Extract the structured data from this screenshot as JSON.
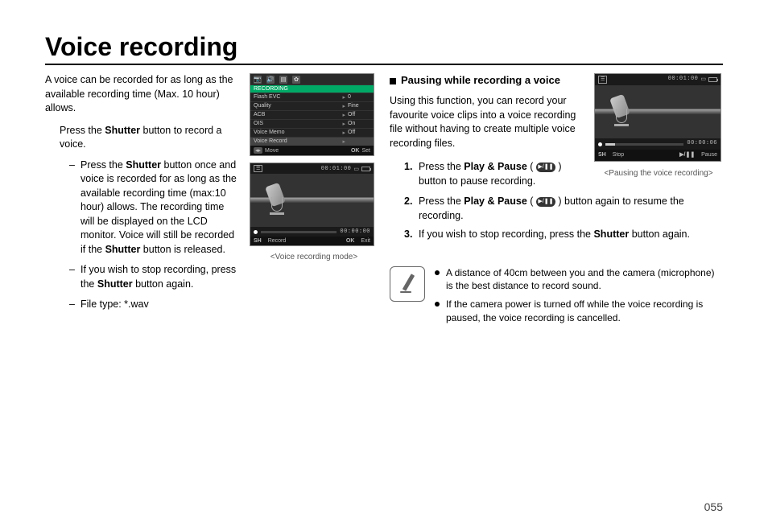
{
  "title": "Voice recording",
  "page_number": "055",
  "left": {
    "intro": "A voice can be recorded for as long as the available recording time (Max. 10 hour) allows.",
    "press_line_pre": "Press the ",
    "shutter_word": "Shutter",
    "press_line_post": " button to record a voice.",
    "bullets": [
      {
        "pre": "Press the ",
        "b1": "Shutter",
        "mid": " button once and voice is recorded for as long as the available recording time (max:10 hour) allows. The recording time will be displayed on the LCD monitor. Voice will still be recorded if the ",
        "b2": "Shutter",
        "post": " button is released."
      },
      {
        "pre": "If you wish to stop recording, press the ",
        "b1": "Shutter",
        "post": " button again."
      },
      {
        "plain": "File type: *.wav"
      }
    ]
  },
  "menu_shot": {
    "header": "RECORDING",
    "rows": [
      {
        "label": "Flash EVC",
        "value": "0"
      },
      {
        "label": "Quality",
        "value": "Fine"
      },
      {
        "label": "ACB",
        "value": "Off"
      },
      {
        "label": "OIS",
        "value": "On"
      },
      {
        "label": "Voice Memo",
        "value": "Off"
      },
      {
        "label": "Voice Record",
        "value": ""
      }
    ],
    "foot_left": "Move",
    "foot_right_k": "OK",
    "foot_right_v": "Set"
  },
  "rec_shot": {
    "top_time": "00:01:00",
    "bar_time": "00:00:00",
    "foot_l_k": "SH",
    "foot_l_v": "Record",
    "foot_r_k": "OK",
    "foot_r_v": "Exit",
    "caption": "<Voice recording mode>"
  },
  "right": {
    "section_title": "Pausing while recording a voice",
    "para": "Using this function, you can record your favourite voice clips into a voice recording file without having to create multiple voice recording files.",
    "steps": [
      {
        "n": "1.",
        "pre": "Press the ",
        "b": "Play & Pause",
        "mid": " ( ",
        "post": " ) button to pause recording."
      },
      {
        "n": "2.",
        "pre": "Press the ",
        "b": "Play & Pause",
        "mid": " ( ",
        "post": " ) button again to resume the recording."
      },
      {
        "n": "3.",
        "pre": "If you wish to stop recording, press the ",
        "b": "Shutter",
        "post": " button again."
      }
    ]
  },
  "pause_shot": {
    "top_time": "00:01:00",
    "bar_time": "00:00:06",
    "foot_l_k": "SH",
    "foot_l_v": "Stop",
    "foot_r_k": "▶/❚❚",
    "foot_r_v": "Pause",
    "caption": "<Pausing the voice recording>"
  },
  "notes": [
    "A distance of 40cm between you and the camera (microphone) is the best distance to record sound.",
    "If the camera power is turned off while the voice recording is paused, the voice recording is cancelled."
  ]
}
